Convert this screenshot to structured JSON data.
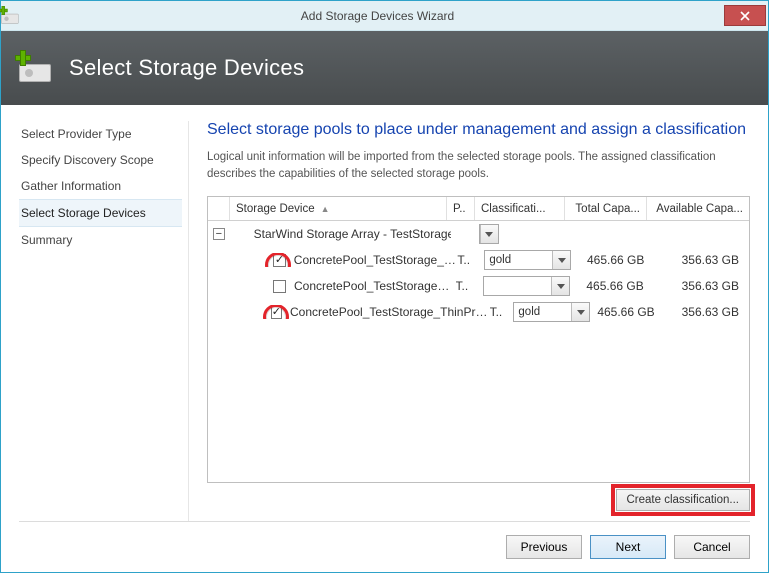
{
  "window": {
    "title": "Add Storage Devices Wizard"
  },
  "hero": {
    "title": "Select Storage Devices"
  },
  "sidebar": {
    "steps": [
      {
        "label": "Select Provider Type"
      },
      {
        "label": "Specify Discovery Scope"
      },
      {
        "label": "Gather Information"
      },
      {
        "label": "Select Storage Devices"
      },
      {
        "label": "Summary"
      }
    ],
    "currentIndex": 3
  },
  "main": {
    "heading": "Select storage pools to place under management and assign a classification",
    "description": "Logical unit information will be imported from the selected storage pools. The assigned classification describes the capabilities of the selected storage pools."
  },
  "grid": {
    "columns": {
      "device": "Storage Device",
      "p": "P..",
      "classification": "Classificati...",
      "totalCap": "Total Capa...",
      "availCap": "Available Capa..."
    },
    "groupLabel": "StarWind Storage Array - TestStorage",
    "rows": [
      {
        "checked": true,
        "name": "ConcretePool_TestStorage_Flat",
        "p": "T..",
        "classification": "gold",
        "totalCap": "465.66 GB",
        "availCap": "356.63 GB"
      },
      {
        "checked": false,
        "name": "ConcretePool_TestStorage_HA",
        "p": "T..",
        "classification": "",
        "totalCap": "465.66 GB",
        "availCap": "356.63 GB"
      },
      {
        "checked": true,
        "name": "ConcretePool_TestStorage_ThinProvisioned",
        "p": "T..",
        "classification": "gold",
        "totalCap": "465.66 GB",
        "availCap": "356.63 GB"
      }
    ]
  },
  "actions": {
    "createClassification": "Create classification...",
    "previous": "Previous",
    "next": "Next",
    "cancel": "Cancel"
  }
}
